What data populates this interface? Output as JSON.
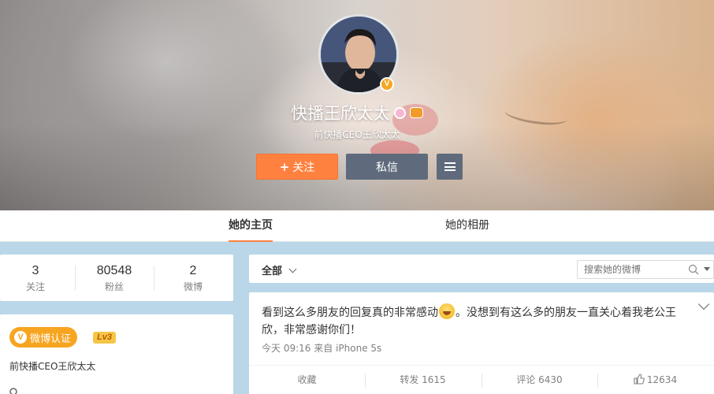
{
  "profile": {
    "name": "快播王欣太太",
    "subtitle": "前快播CEO王欣太太",
    "verified_mark": "V"
  },
  "buttons": {
    "follow": "关注",
    "follow_icon": "+",
    "message": "私信",
    "more_icon": "menu-icon"
  },
  "tabs": [
    {
      "label": "她的主页",
      "active": true
    },
    {
      "label": "她的相册",
      "active": false
    }
  ],
  "stats": [
    {
      "num": "3",
      "label": "关注"
    },
    {
      "num": "80548",
      "label": "粉丝"
    },
    {
      "num": "2",
      "label": "微博"
    }
  ],
  "info": {
    "verified_label": "微博认证",
    "verified_mark": "V",
    "level": "Lv3",
    "description": "前快播CEO王欣太太"
  },
  "feed": {
    "filter": "全部",
    "search_placeholder": "搜索她的微博",
    "post": {
      "text_before": "看到这么多朋友的回复真的非常感动",
      "text_after": "。没想到有这么多的朋友一直关心着我老公王欣，非常感谢你们！",
      "time": "今天 09:16",
      "source_prefix": "来自",
      "source": "iPhone 5s",
      "actions": {
        "favorite": "收藏",
        "repost": "转发 1615",
        "comment": "评论 6430",
        "like": "12634"
      }
    }
  },
  "colors": {
    "accent": "#ff8140",
    "secondary_button": "#5f6b7c",
    "page_bg": "#b9d7e8",
    "verified": "#f7a521"
  }
}
